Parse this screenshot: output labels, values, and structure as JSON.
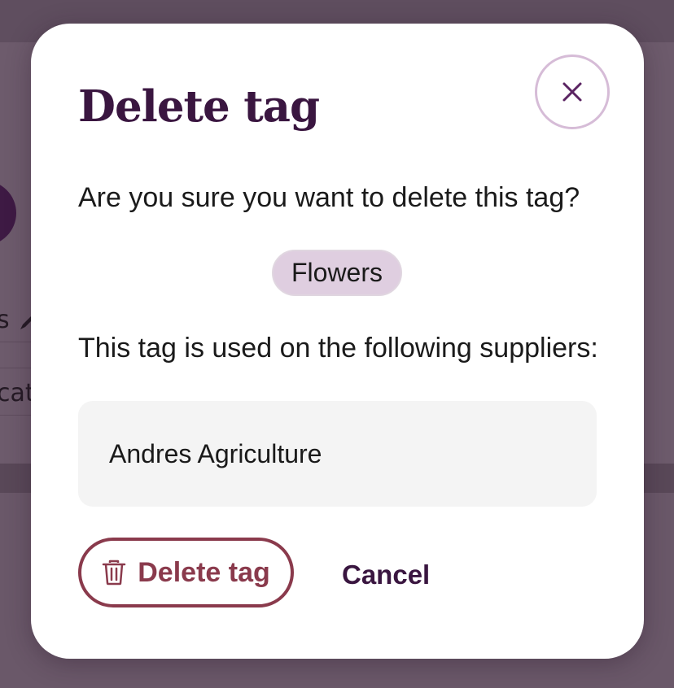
{
  "background": {
    "partial_text_1": "s",
    "partial_text_2": "cat"
  },
  "modal": {
    "title": "Delete tag",
    "close_icon": "close-icon",
    "question": "Are you sure you want to delete this tag?",
    "tag_label": "Flowers",
    "usage_text": "This tag is used on the following suppliers:",
    "suppliers": [
      "Andres Agriculture"
    ],
    "delete_label": "Delete tag",
    "delete_icon": "trash-icon",
    "cancel_label": "Cancel"
  },
  "colors": {
    "overlay": "#6a5869",
    "title": "#3a1640",
    "danger": "#8a3a4c",
    "tag_bg": "#dfcee0",
    "close_border": "#d6bcd7",
    "list_bg": "#f4f4f4"
  }
}
